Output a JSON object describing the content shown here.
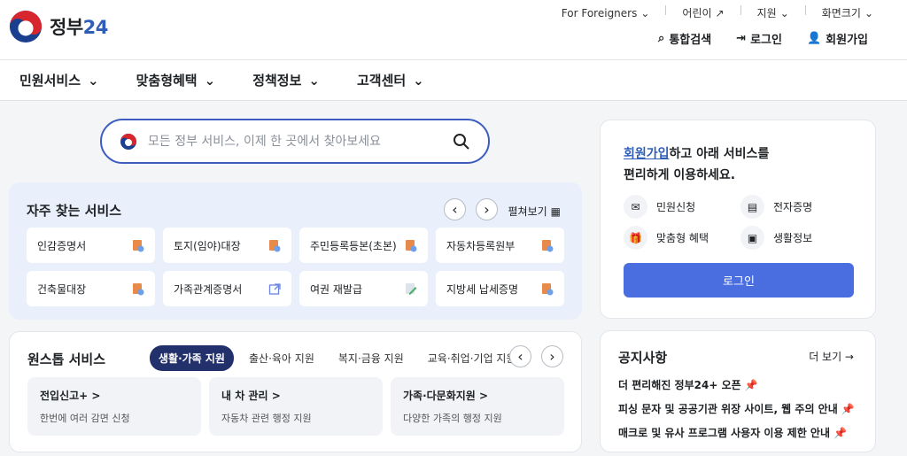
{
  "header": {
    "logo_text": "정부",
    "logo_num": "24",
    "util": [
      "For Foreigners",
      "어린이",
      "지원",
      "화면크기"
    ],
    "actions": {
      "search": "통합검색",
      "login": "로그인",
      "signup": "회원가입"
    }
  },
  "gnb": [
    "민원서비스",
    "맞춤형혜택",
    "정책정보",
    "고객센터"
  ],
  "search": {
    "placeholder": "모든 정부 서비스, 이제 한 곳에서 찾아보세요"
  },
  "frequent": {
    "title": "자주 찾는 서비스",
    "expand": "펼쳐보기",
    "items": [
      "인감증명서",
      "토지(임야)대장",
      "주민등록등본(초본)",
      "자동차등록원부",
      "건축물대장",
      "가족관계증명서",
      "여권 재발급",
      "지방세 납세증명"
    ]
  },
  "onestop": {
    "title": "원스톱 서비스",
    "chips": [
      "생활·가족 지원",
      "출산·육아 지원",
      "복지·금융 지원",
      "교육·취업·기업 지원"
    ],
    "cards": [
      {
        "title": "전입신고+ >",
        "desc": "한번에 여러 감면 신청"
      },
      {
        "title": "내 차 관리 >",
        "desc": "자동차 관련 행정 지원"
      },
      {
        "title": "가족·다문화지원 >",
        "desc": "다양한 가족의 행정 지원"
      }
    ]
  },
  "member": {
    "link": "회원가입",
    "lead_rest": "하고 아래 서비스를",
    "lead_line2": "편리하게 이용하세요.",
    "services": [
      "민원신청",
      "전자증명",
      "맞춤형 혜택",
      "생활정보"
    ],
    "login_button": "로그인"
  },
  "notice": {
    "title": "공지사항",
    "more": "더 보기 →",
    "items": [
      "더 편리해진 정부24+ 오픈",
      "피싱 문자 및 공공기관 위장 사이트, 웹 주의 안내",
      "매크로 및 유사 프로그램 사용자 이용 제한 안내"
    ]
  },
  "colors": {
    "accent": "#4a6ee0",
    "brand_blue": "#2f5eb8",
    "chip_active": "#22316b",
    "section_bg": "#eaf0fb"
  }
}
